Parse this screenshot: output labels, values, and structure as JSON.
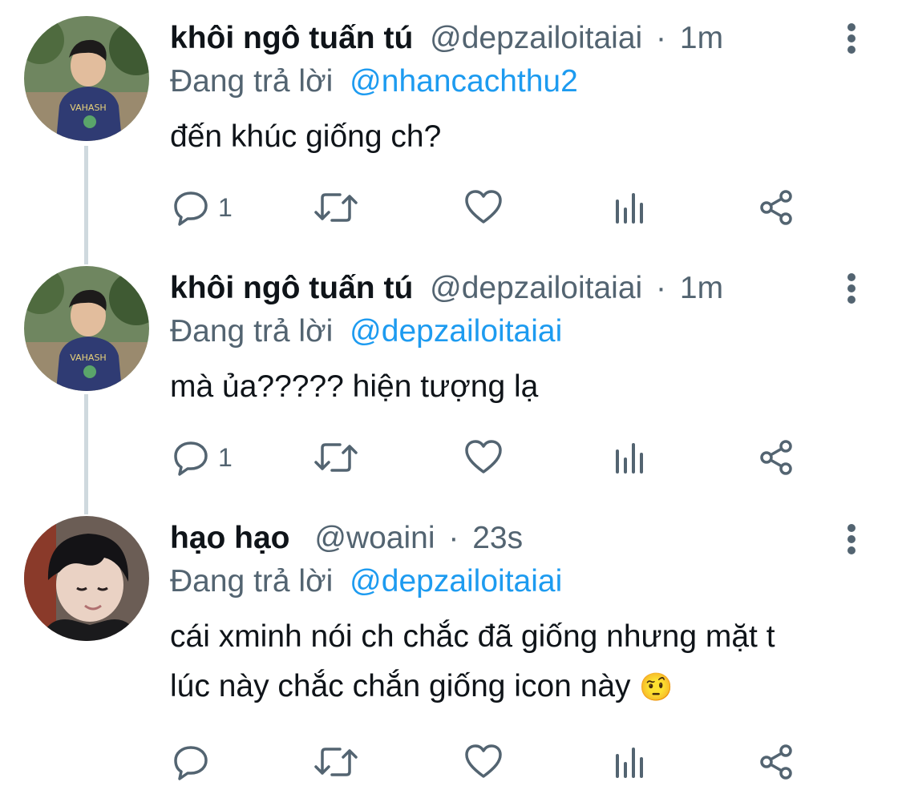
{
  "tweets": [
    {
      "name": "khôi ngô tuấn tú",
      "handle": "@depzailoitaiai",
      "separator": "·",
      "time": "1m",
      "reply_prefix": "Đang trả lời",
      "reply_to": "@nhancachthu2",
      "text_lines": [
        "đến khúc giống ch?"
      ],
      "reply_count": "1",
      "avatar_icon": "profile-photo"
    },
    {
      "name": "khôi ngô tuấn tú",
      "handle": "@depzailoitaiai",
      "separator": "·",
      "time": "1m",
      "reply_prefix": "Đang trả lời",
      "reply_to": "@depzailoitaiai",
      "text_lines": [
        "mà ủa????? hiện tượng lạ"
      ],
      "reply_count": "1",
      "avatar_icon": "profile-photo"
    },
    {
      "name": "hạo hạo",
      "handle": "@woaini",
      "separator": "·",
      "time": "23s",
      "reply_prefix": "Đang trả lời",
      "reply_to": "@depzailoitaiai",
      "text_lines": [
        "cái xminh nói ch chắc đã giống nhưng mặt t",
        "lúc này chắc chắn giống icon này"
      ],
      "emoji": "🤨",
      "reply_count": "",
      "avatar_icon": "profile-photo"
    }
  ],
  "icons": [
    "reply-icon",
    "retweet-icon",
    "like-icon",
    "views-icon",
    "share-icon",
    "more-options-icon"
  ],
  "colors": {
    "text": "#0f1419",
    "secondary": "#536471",
    "link": "#1d9bf0",
    "thread": "#cfd9de"
  }
}
